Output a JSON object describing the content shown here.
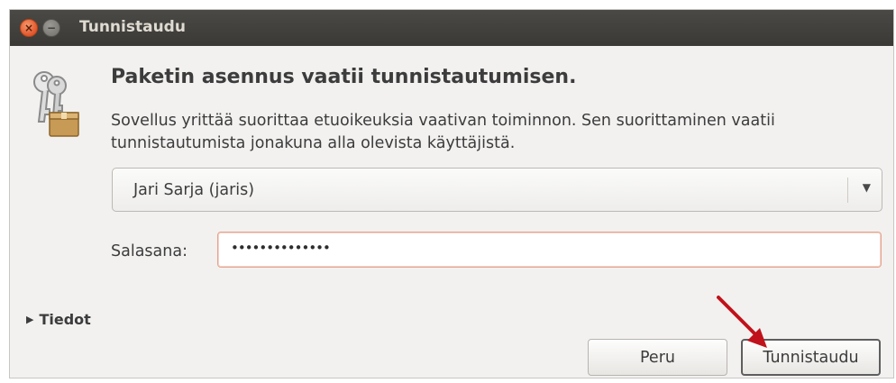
{
  "window": {
    "title": "Tunnistaudu"
  },
  "titlebar_buttons": {
    "close_icon": "close-icon",
    "minimize_icon": "minimize-icon",
    "close_glyph": "×",
    "minimize_glyph": "−"
  },
  "dialog": {
    "icon": "keys-package-icon",
    "heading": "Paketin asennus vaatii tunnistautumisen.",
    "description": "Sovellus yrittää suorittaa etuoikeuksia vaativan toiminnon. Sen suorittaminen vaatii tunnistautumista jonakuna alla olevista käyttäjistä."
  },
  "user_select": {
    "value": "Jari Sarja (jaris)",
    "arrow_glyph": "▼"
  },
  "password": {
    "label": "Salasana:",
    "masked_value": "••••••••••••••"
  },
  "details": {
    "label": "Tiedot",
    "expander_glyph": "▶"
  },
  "buttons": {
    "cancel_label": "Peru",
    "authenticate_label": "Tunnistaudu"
  },
  "colors": {
    "titlebar": "#3c3b37",
    "close_button": "#e95420",
    "annotation_arrow": "#c0121b",
    "password_focus_border": "#e6a48f"
  }
}
